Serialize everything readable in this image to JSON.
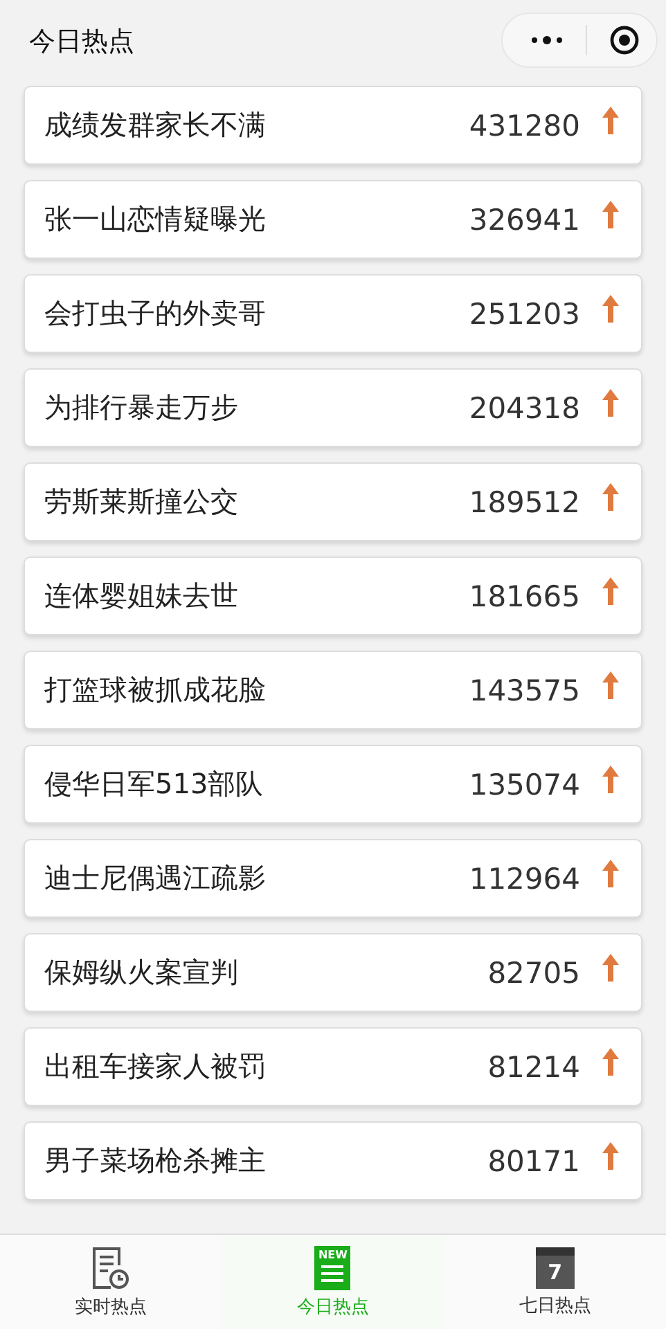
{
  "nav_bar": {
    "title": "今日热点"
  },
  "items": [
    {
      "title": "成绩发群家长不满",
      "count": "431280"
    },
    {
      "title": "张一山恋情疑曝光",
      "count": "326941"
    },
    {
      "title": "会打虫子的外卖哥",
      "count": "251203"
    },
    {
      "title": "为排行暴走万步",
      "count": "204318"
    },
    {
      "title": "劳斯莱斯撞公交",
      "count": "189512"
    },
    {
      "title": "连体婴姐妹去世",
      "count": "181665"
    },
    {
      "title": "打篮球被抓成花脸",
      "count": "143575"
    },
    {
      "title": "侵华日军513部队",
      "count": "135074"
    },
    {
      "title": "迪士尼偶遇江疏影",
      "count": "112964"
    },
    {
      "title": "保姆纵火案宣判",
      "count": "82705"
    },
    {
      "title": "出租车接家人被罚",
      "count": "81214"
    },
    {
      "title": "男子菜场枪杀摊主",
      "count": "80171"
    }
  ],
  "tab_bar": [
    {
      "label": "实时热点",
      "kind": "clock",
      "selected": false
    },
    {
      "label": "今日热点",
      "kind": "new",
      "icon_text": "NEW",
      "selected": true
    },
    {
      "label": "七日热点",
      "kind": "calendar",
      "icon_text": "7",
      "selected": false
    }
  ]
}
